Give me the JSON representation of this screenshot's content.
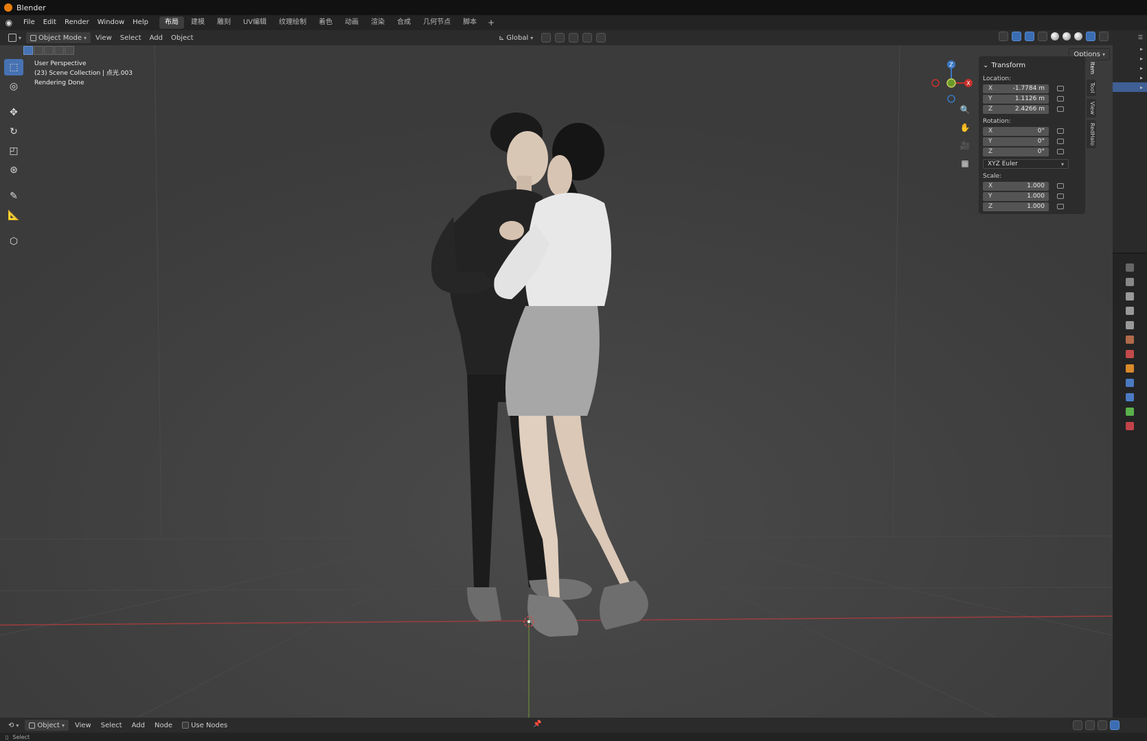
{
  "window": {
    "title": "Blender"
  },
  "menubar": {
    "items": [
      "File",
      "Edit",
      "Render",
      "Window",
      "Help"
    ],
    "workspaces": [
      "布局",
      "建模",
      "雕刻",
      "UV编辑",
      "纹理绘制",
      "着色",
      "动画",
      "渲染",
      "合成",
      "几何节点",
      "脚本"
    ],
    "active_workspace": "布局",
    "add_tab": "+"
  },
  "viewport_header": {
    "mode": "Object Mode",
    "menus": [
      "View",
      "Select",
      "Add",
      "Object"
    ],
    "orientation": "Global",
    "options": "Options"
  },
  "viewport": {
    "info_line1": "User Perspective",
    "info_line2": "(23) Scene Collection | 点光.003",
    "info_line3": "Rendering Done"
  },
  "gizmo": {
    "z": "Z",
    "x": "X"
  },
  "npanel": {
    "section": "Transform",
    "location_label": "Location:",
    "location": [
      {
        "axis": "X",
        "value": "-1.7784 m"
      },
      {
        "axis": "Y",
        "value": "1.1126 m"
      },
      {
        "axis": "Z",
        "value": "2.4266 m"
      }
    ],
    "rotation_label": "Rotation:",
    "rotation": [
      {
        "axis": "X",
        "value": "0°"
      },
      {
        "axis": "Y",
        "value": "0°"
      },
      {
        "axis": "Z",
        "value": "0°"
      }
    ],
    "rotation_mode": "XYZ Euler",
    "scale_label": "Scale:",
    "scale": [
      {
        "axis": "X",
        "value": "1.000"
      },
      {
        "axis": "Y",
        "value": "1.000"
      },
      {
        "axis": "Z",
        "value": "1.000"
      }
    ],
    "tabs": [
      "Item",
      "Tool",
      "View",
      "RedHalo"
    ]
  },
  "shader_header": {
    "type": "Object",
    "menus": [
      "View",
      "Select",
      "Add",
      "Node"
    ],
    "use_nodes_label": "Use Nodes"
  },
  "statusbar": {
    "select": "Select"
  },
  "colors": {
    "accent": "#4772b3",
    "viewport_bg": "#3f3f3f",
    "x_axis": "#c9302c",
    "y_axis": "#6a9a2a",
    "z_axis": "#3b78c4"
  }
}
